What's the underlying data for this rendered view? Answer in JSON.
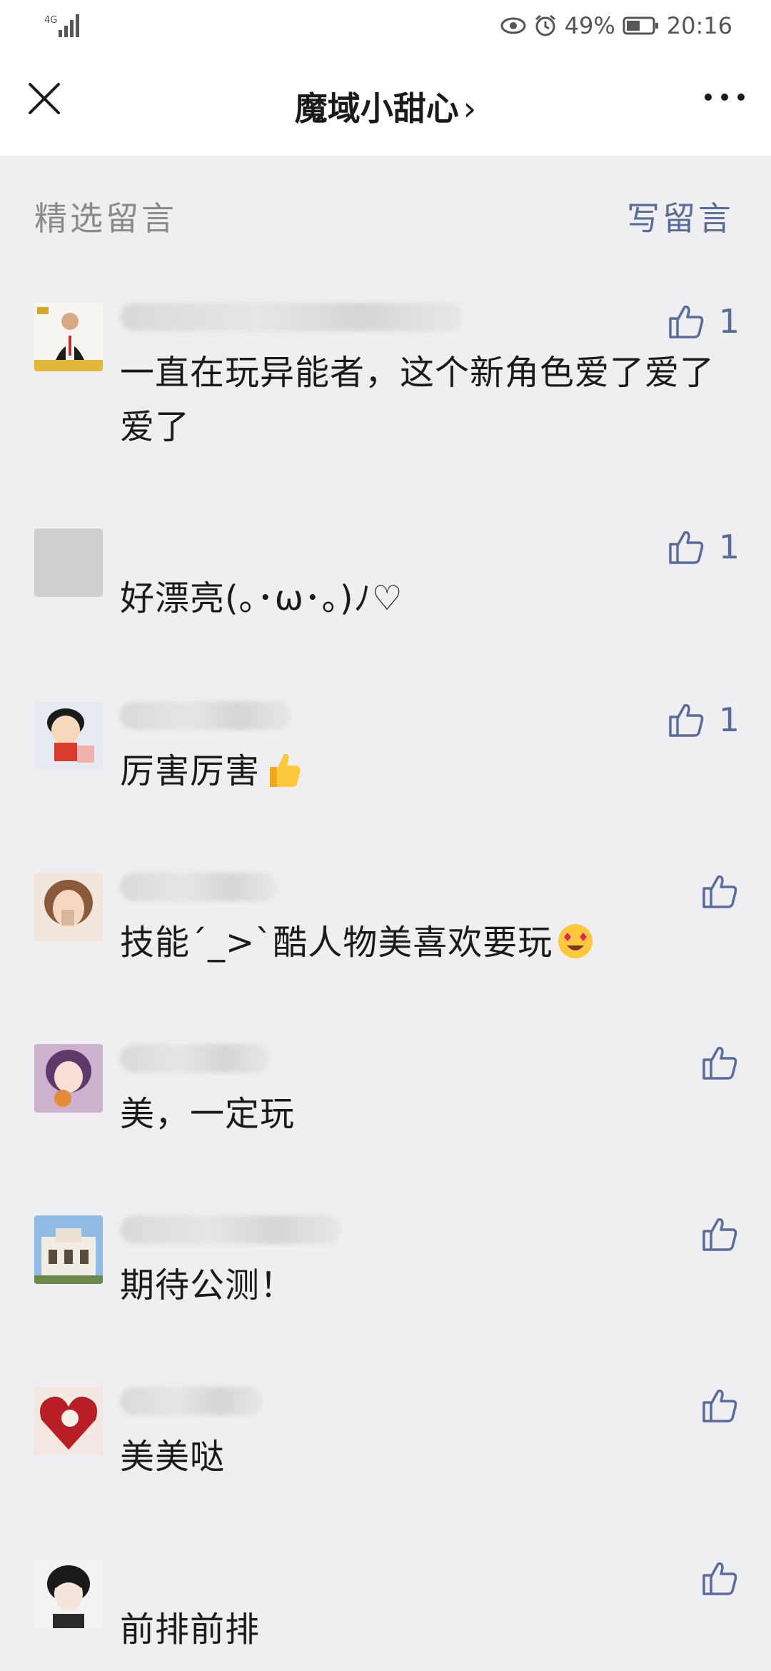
{
  "status_bar": {
    "network": "4G",
    "battery_percent": "49%",
    "time": "20:16"
  },
  "nav": {
    "title": "魔域小甜心",
    "title_chevron": "›"
  },
  "section": {
    "title": "精选留言",
    "write_label": "写留言"
  },
  "comments": [
    {
      "text": "一直在玩异能者，这个新角色爱了爱了爱了",
      "likes": "1"
    },
    {
      "text": "好漂亮(｡･ω･｡)ﾉ♡",
      "likes": "1"
    },
    {
      "text": "厉害厉害",
      "likes": "1"
    },
    {
      "text": "技能´_>`酷人物美喜欢要玩",
      "likes": ""
    },
    {
      "text": "美，一定玩",
      "likes": ""
    },
    {
      "text": "期待公测！",
      "likes": ""
    },
    {
      "text": "美美哒",
      "likes": ""
    },
    {
      "text": "前排前排",
      "likes": ""
    }
  ],
  "colors": {
    "accent": "#5a6c99",
    "background": "#efeff1",
    "muted_text": "#8a8a8a"
  }
}
